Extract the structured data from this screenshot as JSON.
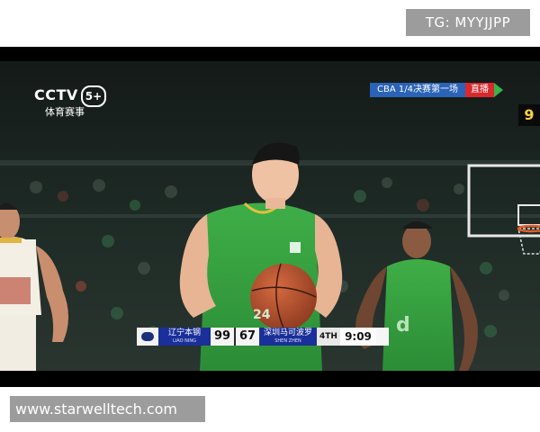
{
  "watermarks": {
    "top_right": "TG: MYYJJPP",
    "bottom_left": "www.starwelltech.com"
  },
  "broadcast": {
    "channel_logo": "CCTV",
    "channel_number": "5+",
    "channel_subtitle": "体育赛事",
    "event_title": "CBA 1/4决赛第一场",
    "live_label": "直播"
  },
  "scoreboard": {
    "home_team": "辽宁本钢",
    "home_team_en": "LIAO NING",
    "home_score": "99",
    "away_score": "67",
    "away_team": "深圳马可波罗",
    "away_team_en": "SHEN ZHEN",
    "period": "4TH",
    "game_clock": "9:09",
    "shot_clock": "9"
  },
  "scene": {
    "foreground_jersey_number": "24",
    "colors": {
      "green_jersey": "#33a23e",
      "white_jersey": "#f4efe4",
      "ball": "#c0522c",
      "crowd": "#1f2a26"
    }
  }
}
